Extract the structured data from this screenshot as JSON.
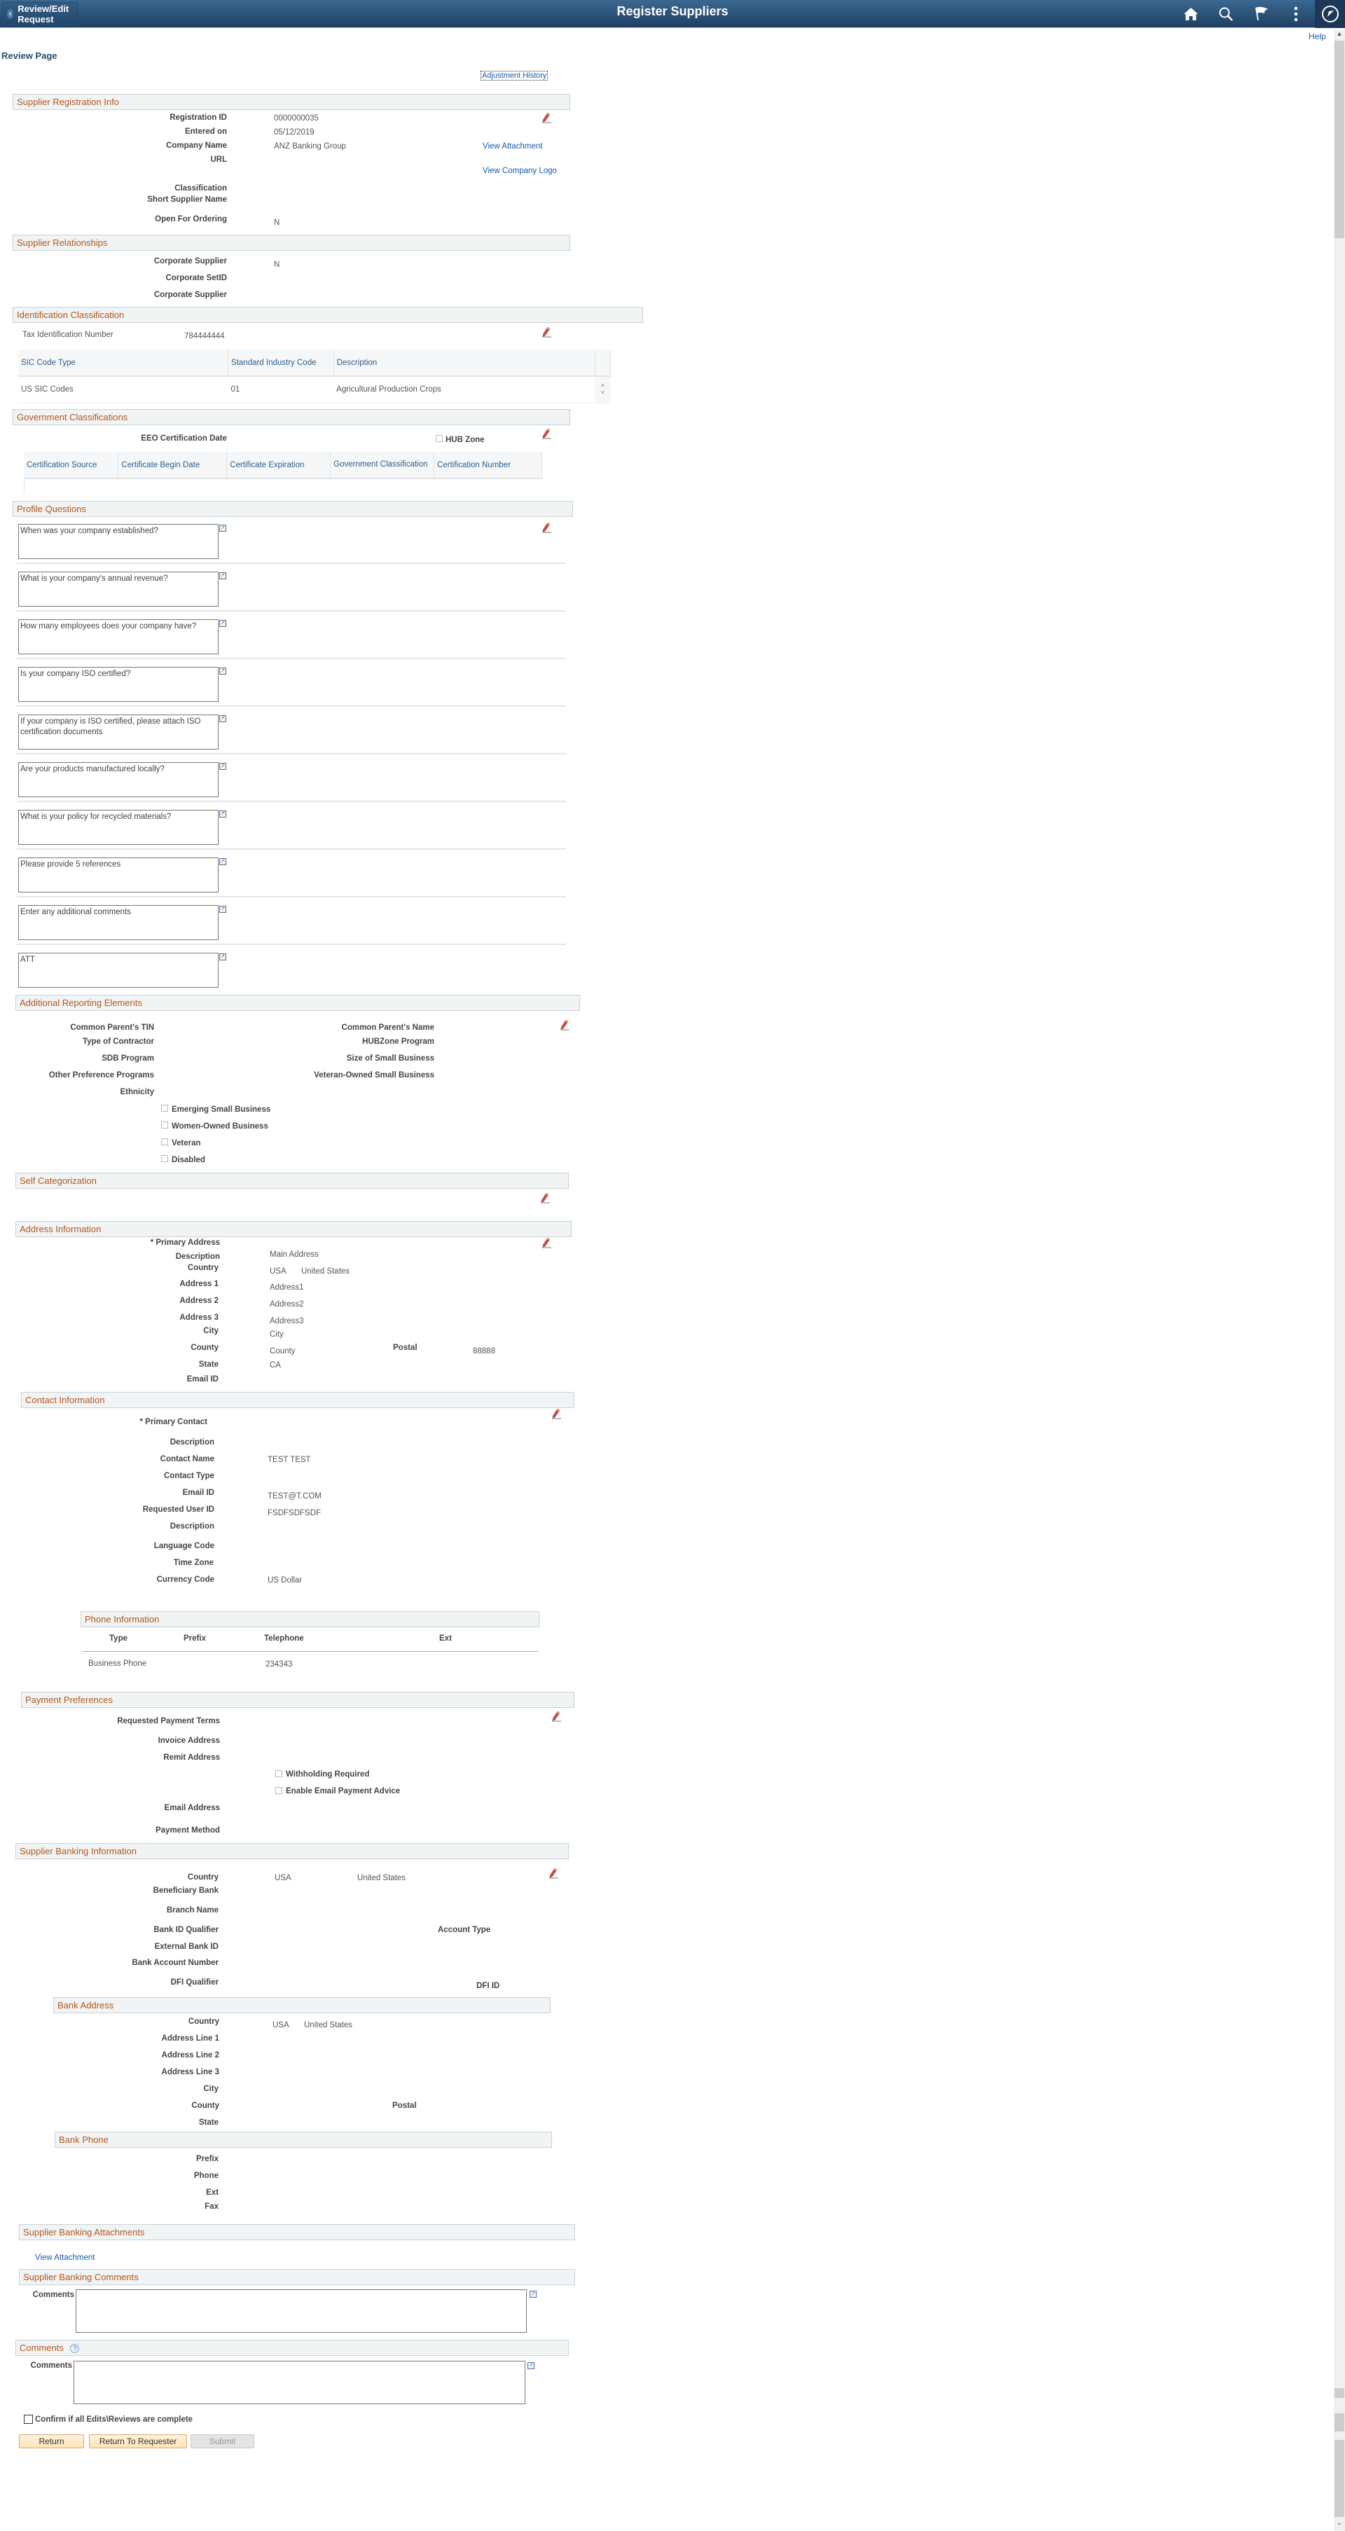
{
  "header": {
    "back_label": "Review/Edit Request",
    "title": "Register Suppliers",
    "icons": [
      "home-icon",
      "search-icon",
      "flag-icon",
      "more-icon",
      "navbar-icon"
    ]
  },
  "help_label": "Help",
  "page_title": "Review Page",
  "adjustment_history": "Adjustment History",
  "registration": {
    "section": "Supplier Registration Info",
    "labels": {
      "registration_id": "Registration ID",
      "entered_on": "Entered on",
      "company_name": "Company Name",
      "url": "URL",
      "classification": "Classification",
      "short_supplier_name": "Short Supplier Name",
      "open_for_ordering": "Open For Ordering"
    },
    "values": {
      "registration_id": "0000000035",
      "entered_on": "05/12/2019",
      "company_name": "ANZ Banking Group",
      "open_for_ordering": "N"
    },
    "view_attachment": "View Attachment",
    "view_company_logo": "View Company Logo"
  },
  "relationships": {
    "section": "Supplier Relationships",
    "labels": [
      "Corporate Supplier",
      "Corporate SetID",
      "Corporate Supplier"
    ],
    "corporate_supplier_value": "N"
  },
  "identification": {
    "section": "Identification Classification",
    "tin_label": "Tax Identification Number",
    "tin_value": "784444444",
    "columns": [
      "SIC Code Type",
      "Standard Industry Code",
      "Description"
    ],
    "rows": [
      [
        "US SIC Codes",
        "01",
        "Agricultural Production Crops"
      ]
    ]
  },
  "government": {
    "section": "Government Classifications",
    "eeo_label": "EEO Certification Date",
    "hub_zone_label": "HUB Zone",
    "hub_zone_checked": false,
    "columns": [
      "Certification Source",
      "Certificate Begin Date",
      "Certificate Expiration",
      "Government Classification",
      "Certification Number"
    ]
  },
  "profile": {
    "section": "Profile Questions",
    "questions": [
      "When was your company established?",
      "What is your company's annual revenue?",
      "How many employees does your company have?",
      "Is your company ISO certified?",
      "If your company is ISO certified, please attach ISO certification documents",
      "Are your products manufactured locally?",
      "What is your policy for recycled materials?",
      "Please provide 5 references",
      "Enter any additional comments",
      "ATT"
    ]
  },
  "reporting": {
    "section": "Additional Reporting Elements",
    "left_labels": [
      "Common Parent's TIN",
      "Type of Contractor",
      "SDB Program",
      "Other Preference Programs",
      "Ethnicity"
    ],
    "right_labels": [
      "Common Parent's Name",
      "HUBZone Program",
      "Size of Small Business",
      "Veteran-Owned Small Business"
    ],
    "checkboxes": [
      {
        "label": "Emerging Small Business",
        "checked": false
      },
      {
        "label": "Women-Owned Business",
        "checked": false
      },
      {
        "label": "Veteran",
        "checked": false
      },
      {
        "label": "Disabled",
        "checked": false
      }
    ]
  },
  "self_categorization": {
    "section": "Self Categorization"
  },
  "address": {
    "section": "Address Information",
    "primary_label": "* Primary Address",
    "labels": [
      "Description",
      "Country",
      "Address 1",
      "Address 2",
      "Address 3",
      "City",
      "County",
      "State",
      "Email ID"
    ],
    "values": {
      "description": "Main Address",
      "country_code": "USA",
      "country_name": "United States",
      "address1": "Address1",
      "address2": "Address2",
      "address3": "Address3",
      "city": "City",
      "county": "County",
      "state": "CA",
      "postal": "88888"
    },
    "postal_label": "Postal"
  },
  "contact": {
    "section": "Contact Information",
    "primary_label": "* Primary Contact",
    "labels": [
      "Description",
      "Contact Name",
      "Contact Type",
      "Email ID",
      "Requested User ID",
      "Description",
      "Language Code",
      "Time Zone",
      "Currency Code"
    ],
    "values": {
      "contact_name": "TEST TEST",
      "email_id": "TEST@T.COM",
      "requested_user_id": "FSDFSDFSDF",
      "currency_code": "US Dollar"
    }
  },
  "phone": {
    "section": "Phone Information",
    "columns": [
      "Type",
      "Prefix",
      "Telephone",
      "Ext"
    ],
    "rows": [
      [
        "Business Phone",
        "",
        "234343",
        ""
      ]
    ]
  },
  "payment": {
    "section": "Payment Preferences",
    "labels": [
      "Requested Payment Terms",
      "Invoice Address",
      "Remit Address",
      "Email Address",
      "Payment Method"
    ],
    "checkboxes": [
      {
        "label": "Withholding Required",
        "checked": false
      },
      {
        "label": "Enable Email Payment Advice",
        "checked": false
      }
    ]
  },
  "banking": {
    "section": "Supplier Banking Information",
    "labels": [
      "Country",
      "Beneficiary Bank",
      "Branch Name",
      "Bank ID Qualifier",
      "External Bank ID",
      "Bank Account Number",
      "DFI Qualifier"
    ],
    "account_type_label": "Account Type",
    "dfi_id_label": "DFI ID",
    "country_code": "USA",
    "country_name": "United States"
  },
  "bank_address": {
    "section": "Bank Address",
    "labels": [
      "Country",
      "Address Line 1",
      "Address Line 2",
      "Address Line 3",
      "City",
      "County",
      "State"
    ],
    "postal_label": "Postal",
    "country_code": "USA",
    "country_name": "United States"
  },
  "bank_phone": {
    "section": "Bank Phone",
    "labels": [
      "Prefix",
      "Phone",
      "Ext",
      "Fax"
    ]
  },
  "bank_attachments": {
    "section": "Supplier Banking Attachments",
    "view_attachment": "View Attachment"
  },
  "bank_comments": {
    "section": "Supplier Banking Comments",
    "label": "Comments",
    "value": ""
  },
  "comments": {
    "section": "Comments",
    "label": "Comments",
    "value": ""
  },
  "confirm": {
    "label": "Confirm if all Edits\\Reviews are complete",
    "checked": false
  },
  "buttons": {
    "return": "Return",
    "return_to_requester": "Return To Requester",
    "submit": "Submit"
  }
}
